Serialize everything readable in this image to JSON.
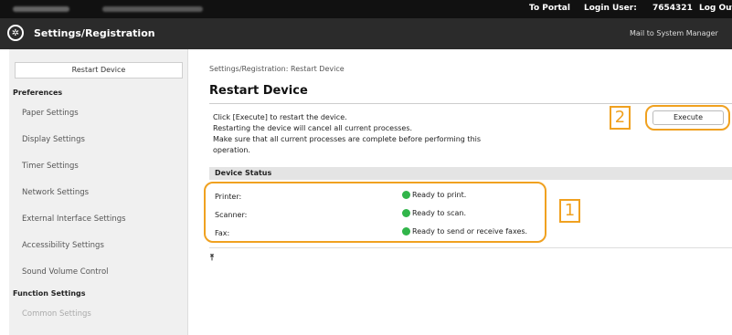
{
  "topbar": {
    "portal_link": "To Portal",
    "login_label": "Login User:",
    "login_user": "7654321",
    "logout_link": "Log Out"
  },
  "header": {
    "title": "Settings/Registration",
    "mail_link": "Mail to System Manager"
  },
  "sidebar": {
    "restart_button": "Restart Device",
    "preferences_heading": "Preferences",
    "items": [
      "Paper Settings",
      "Display Settings",
      "Timer Settings",
      "Network Settings",
      "External Interface Settings",
      "Accessibility Settings",
      "Sound Volume Control"
    ],
    "function_heading": "Function Settings",
    "next_item": "Common Settings"
  },
  "main": {
    "breadcrumb": "Settings/Registration: Restart Device",
    "title": "Restart Device",
    "desc_lines": [
      "Click [Execute] to restart the device.",
      "Restarting the device will cancel all current processes.",
      "Make sure that all current processes are complete before performing this",
      "operation."
    ],
    "execute_button": "Execute",
    "callout_execute": "2",
    "callout_status": "1",
    "status_heading": "Device Status",
    "status": [
      {
        "label": "Printer:",
        "value": "Ready to print."
      },
      {
        "label": "Scanner:",
        "value": "Ready to scan."
      },
      {
        "label": "Fax:",
        "value": "Ready to send or receive faxes."
      }
    ],
    "status_color": "#31b54a",
    "accent_color": "#f0a120",
    "back_to_top_icon": "back-to-top-icon"
  }
}
